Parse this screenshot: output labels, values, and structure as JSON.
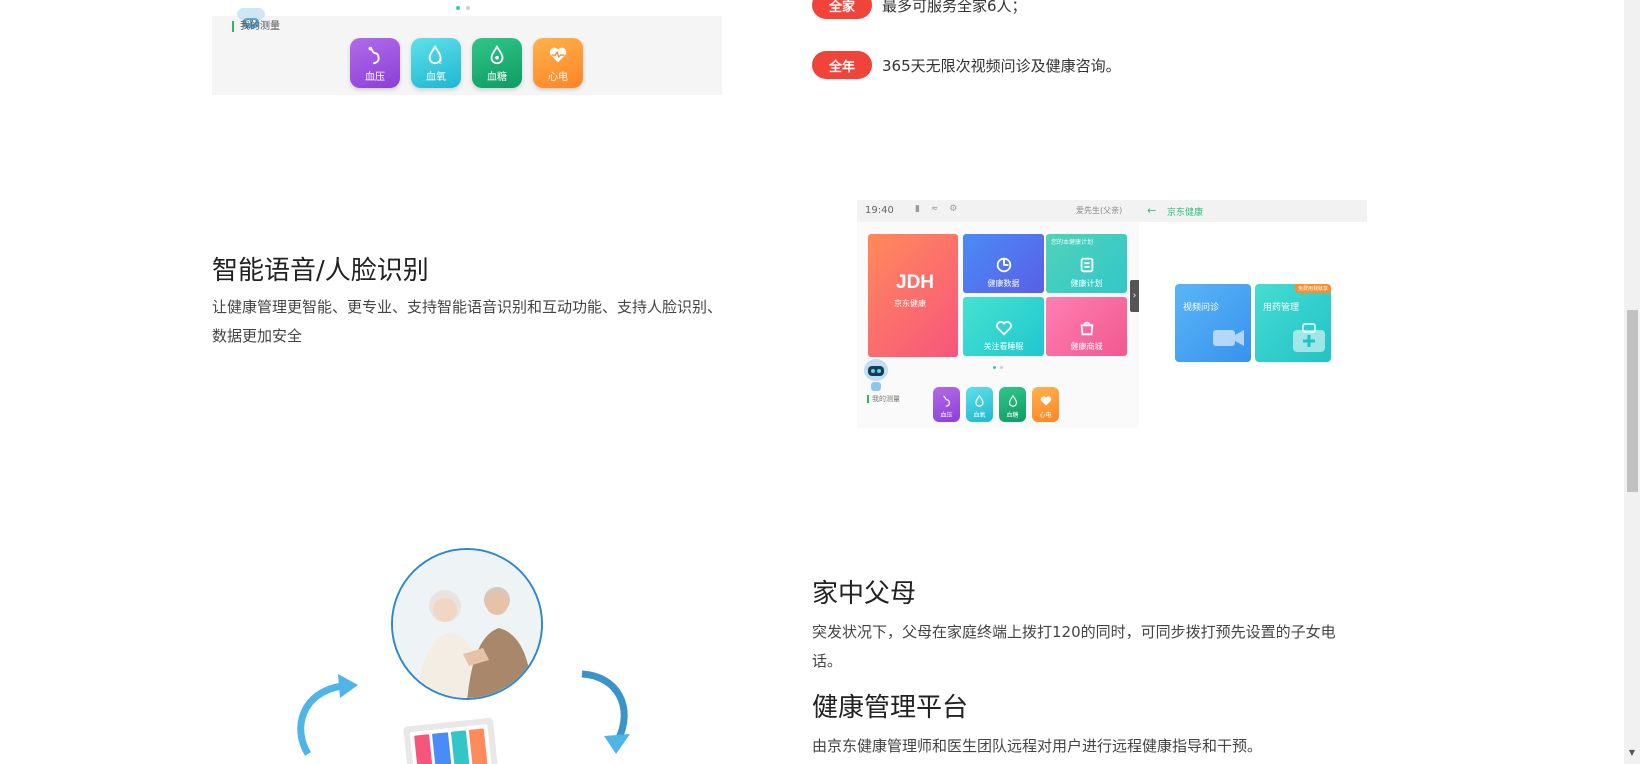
{
  "section1": {
    "my_measure": "我的测量",
    "tiles": [
      {
        "label": "血压",
        "icon": "blood-pressure-icon"
      },
      {
        "label": "血氧",
        "icon": "blood-oxygen-icon"
      },
      {
        "label": "血糖",
        "icon": "blood-sugar-icon"
      },
      {
        "label": "心电",
        "icon": "ecg-heart-icon"
      }
    ],
    "features": [
      {
        "pill": "全家",
        "text": "最多可服务全家6人；"
      },
      {
        "pill": "全年",
        "text": "365天无限次视频问诊及健康咨询。"
      }
    ]
  },
  "section2": {
    "title": "智能语音/人脸识别",
    "description": "让健康管理更智能、更专业、支持智能语音识别和互动功能、支持人脸识别、数据更加安全",
    "device": {
      "time": "19:40",
      "user": "爱先生(父亲)",
      "right_title": "京东健康",
      "brand_logo": "JDH",
      "brand_sub": "京东健康",
      "cards": [
        "健康数据",
        "健康计划",
        "关注看睡眠",
        "健康商城"
      ],
      "card2_top": "您的本健康计划",
      "my_measure": "我的测量",
      "tiles": [
        "血压",
        "血氧",
        "血糖",
        "心电"
      ],
      "right_cards": [
        "视频问诊",
        "用药管理"
      ],
      "right_badge": "免费用我就享"
    }
  },
  "section3": {
    "title1": "家中父母",
    "desc1": "突发状况下，父母在家庭终端上拨打120的同时，可同步拨打预先设置的子女电话。",
    "title2": "健康管理平台",
    "desc2": "由京东健康管理师和医生团队远程对用户进行远程健康指导和干预。"
  },
  "colors": {
    "pill_red": "#f0443b",
    "accent_green": "#2fc27a",
    "circle_blue": "#2e87d1",
    "arrow_blue": "#4fb4e6"
  }
}
